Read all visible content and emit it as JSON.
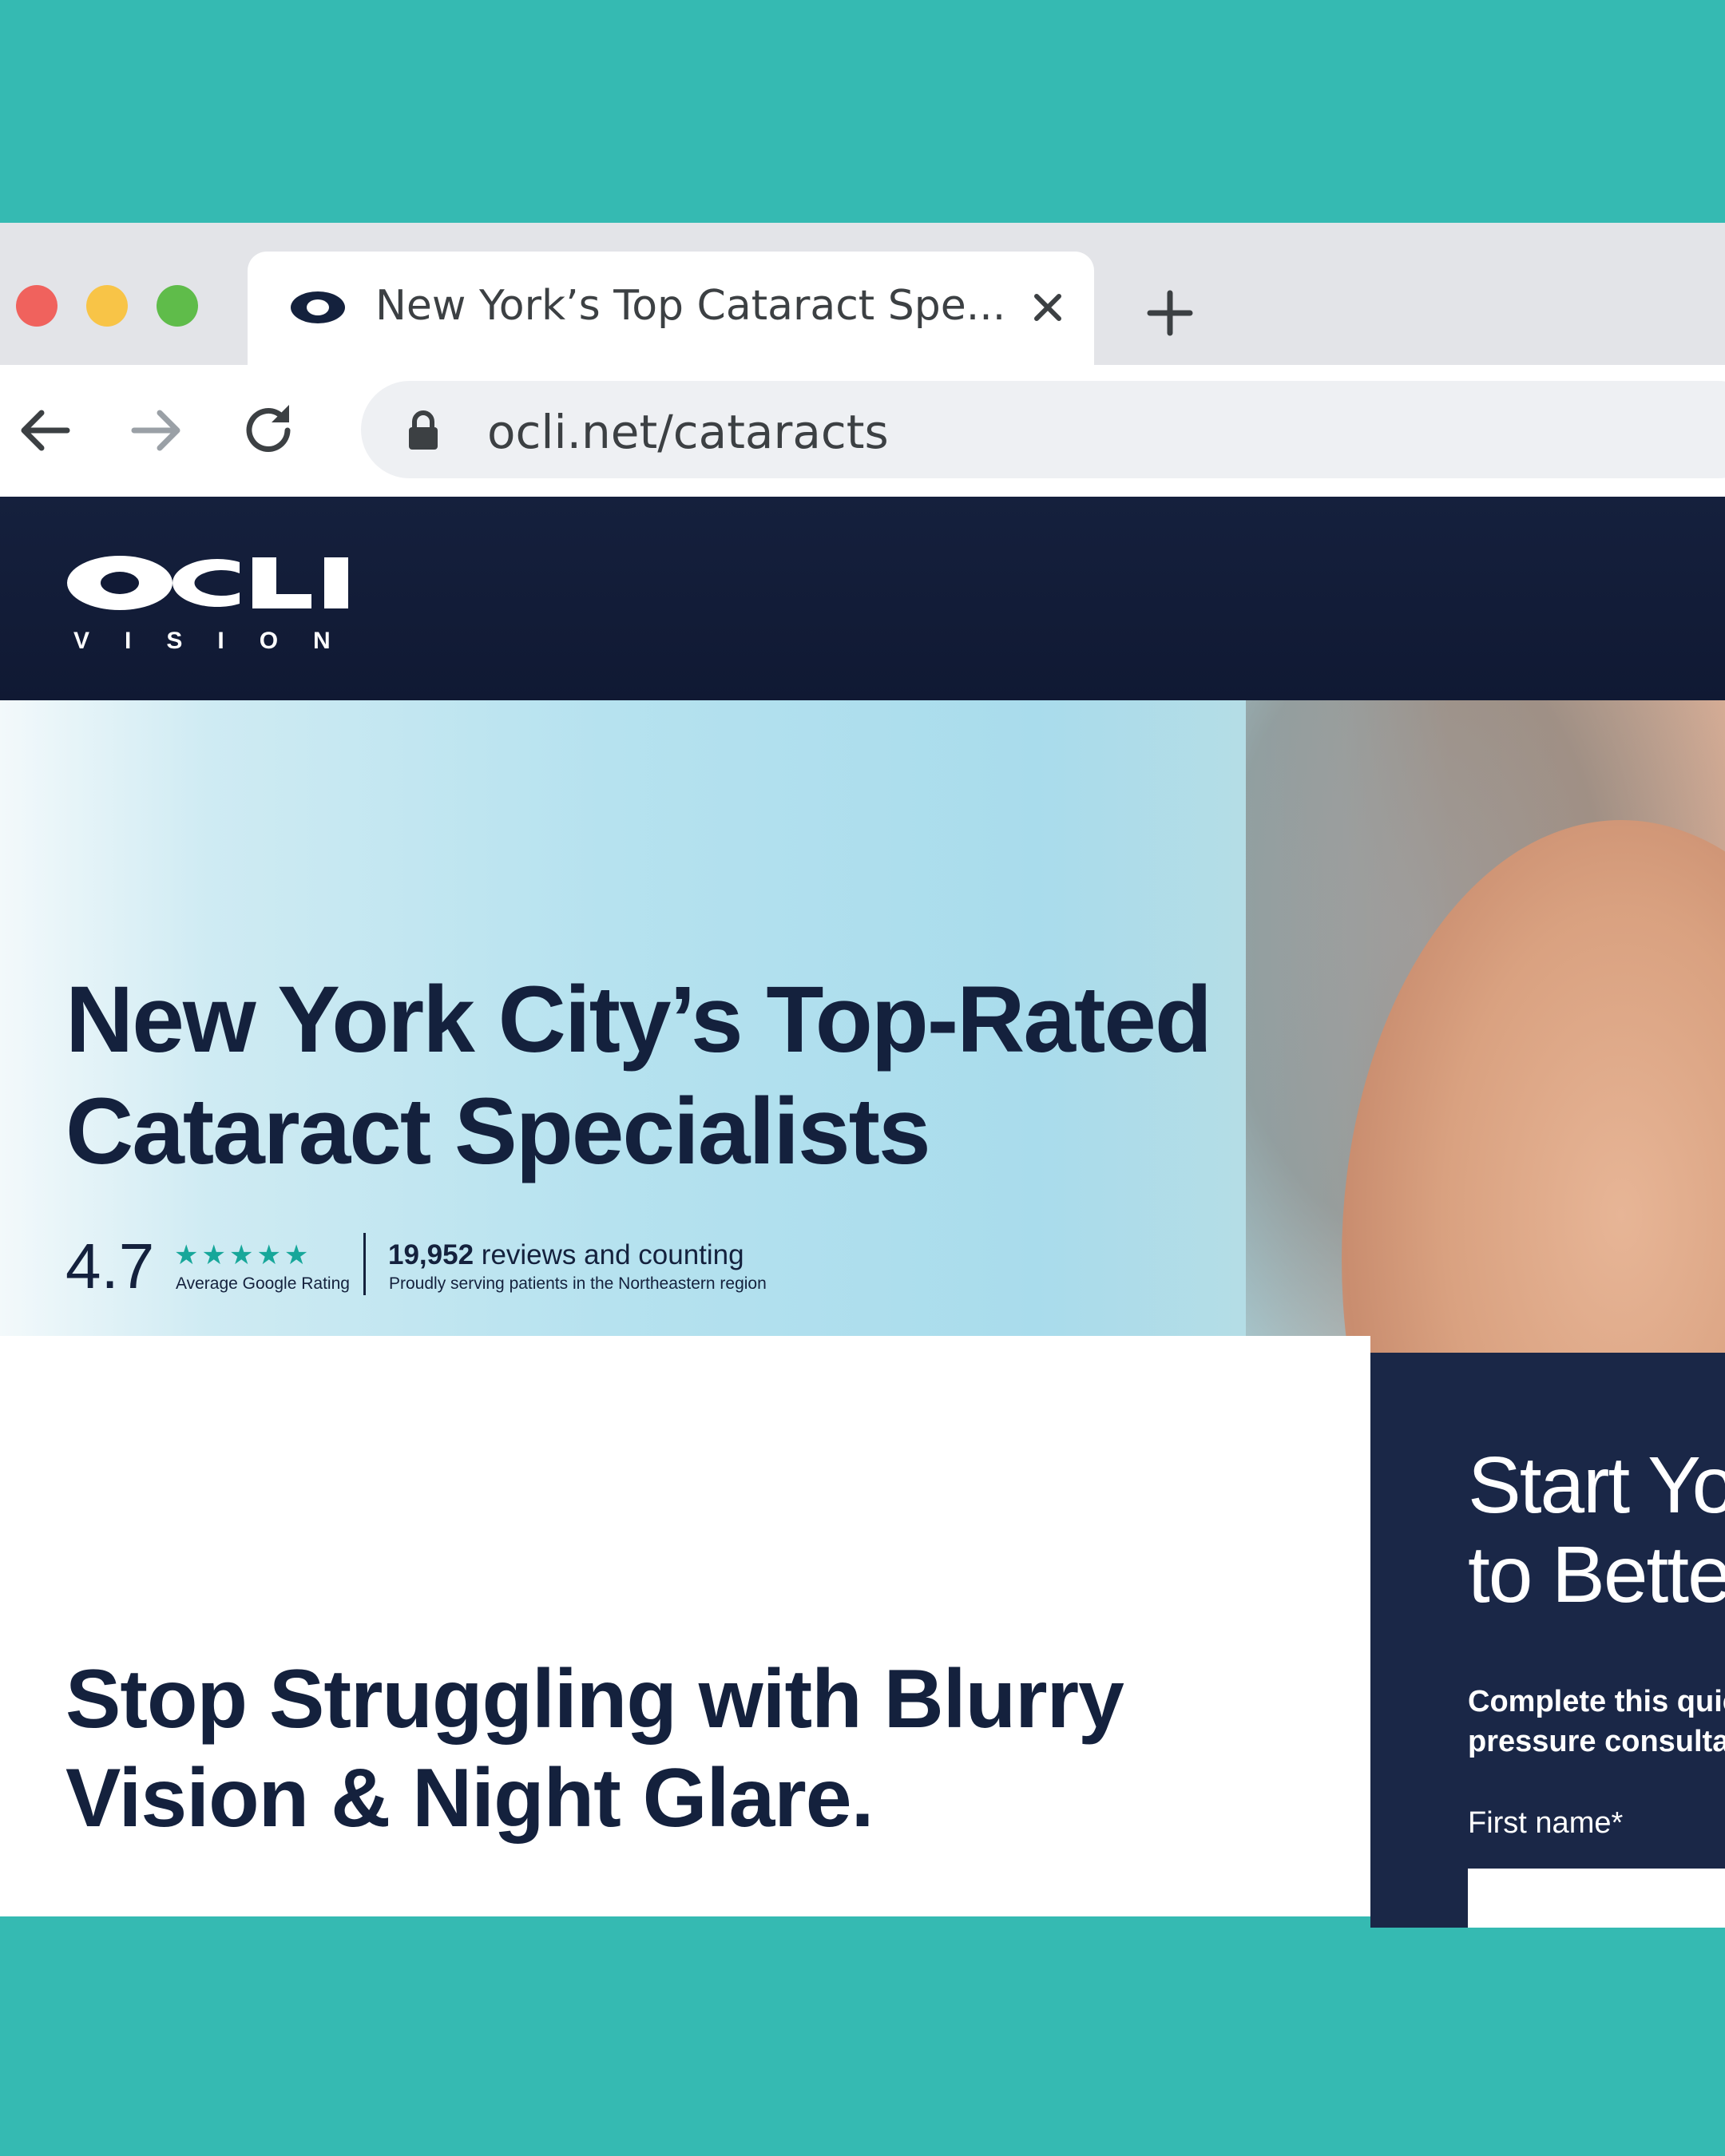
{
  "browser": {
    "tab": {
      "title": "New York’s Top Cataract Spe...",
      "favicon": "eye-icon",
      "close_icon": "close-icon"
    },
    "new_tab_icon": "plus-icon",
    "toolbar": {
      "back_icon": "arrow-left-icon",
      "forward_icon": "arrow-right-icon",
      "reload_icon": "reload-icon",
      "lock_icon": "lock-icon",
      "url": "ocli.net/cataracts"
    },
    "window_controls": [
      "close",
      "minimize",
      "maximize"
    ]
  },
  "site": {
    "logo": {
      "wordmark": "OCLI",
      "subtext": "V I S I O N"
    },
    "hero": {
      "title": "New York City’s Top-Rated Cataract Specialists",
      "rating": {
        "value": "4.7",
        "stars": "★★★★★",
        "caption": "Average Google Rating"
      },
      "reviews": {
        "count": "19,952",
        "label": " reviews and counting",
        "caption": "Proudly serving patients in the Northeastern region"
      }
    },
    "section": {
      "title": "Stop Struggling with Blurry Vision & Night Glare."
    },
    "form": {
      "title_line1": "Start Yo",
      "title_line2": "to Bette",
      "desc_line1": "Complete this quic",
      "desc_line2": "pressure consulta",
      "first_name_label": "First name*",
      "first_name_value": ""
    }
  },
  "colors": {
    "background": "#35bab2",
    "navy": "#14213d",
    "form_panel": "#1a2747",
    "star": "#17a79a"
  }
}
